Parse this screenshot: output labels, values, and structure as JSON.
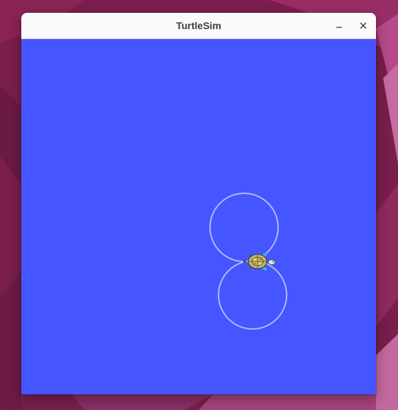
{
  "window": {
    "title": "TurtleSim",
    "minimize_icon": "minimize-icon",
    "close_icon": "close-icon"
  },
  "canvas": {
    "background_color": "#4555ff",
    "pen_color": "#b3b8ff",
    "turtle_icon": "turtle-icon"
  },
  "desktop": {
    "wallpaper_color": "#7a1e4d"
  }
}
